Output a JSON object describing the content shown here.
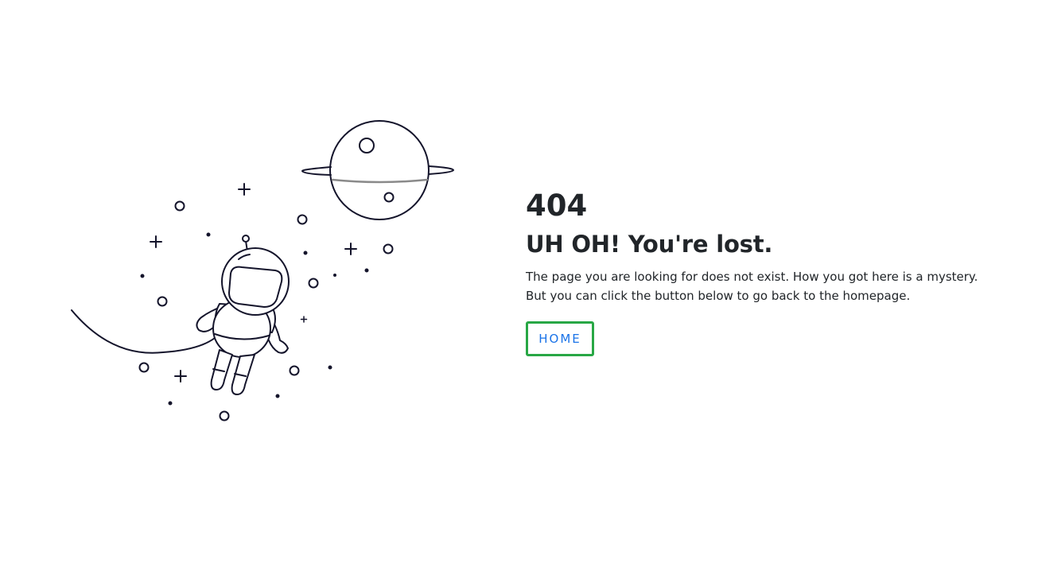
{
  "error": {
    "code": "404",
    "headline": "UH OH! You're lost.",
    "message_line_1": "The page you are looking for does not exist. How you got here is a mystery.",
    "message_line_2": "But you can click the button below to go back to the homepage.",
    "home_button_label": "HOME"
  },
  "illustration": {
    "subject": "astronaut-floating-in-space",
    "elements": [
      "astronaut-icon",
      "planet-icon",
      "moon-icon",
      "star-icon"
    ]
  },
  "colors": {
    "text": "#212529",
    "button_border": "#28a745",
    "button_text": "#1a73e8",
    "line_art": "#14142b",
    "background": "#ffffff"
  }
}
